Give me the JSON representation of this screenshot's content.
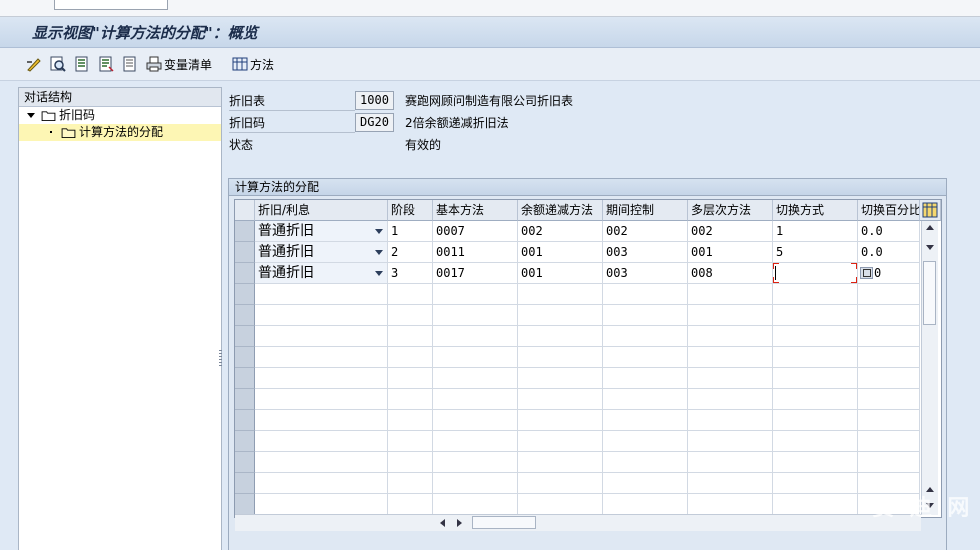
{
  "window": {
    "title": "显示视图\"计算方法的分配\"：概览"
  },
  "toolbar": {
    "variant_list_label": "变量清单",
    "method_label": "方法"
  },
  "tree": {
    "header": "对话结构",
    "items": [
      {
        "label": "折旧码"
      },
      {
        "label": "计算方法的分配"
      }
    ]
  },
  "fields": [
    {
      "label": "折旧表",
      "value": "1000",
      "text": "赛跑网顾问制造有限公司折旧表"
    },
    {
      "label": "折旧码",
      "value": "DG20",
      "text": "2倍余额递减折旧法"
    },
    {
      "label": "状态",
      "value": "",
      "text": "有效的"
    }
  ],
  "table": {
    "title": "计算方法的分配",
    "headers": [
      "折旧/利息",
      "阶段",
      "基本方法",
      "余额递减方法",
      "期间控制",
      "多层次方法",
      "切换方式",
      "切换百分比"
    ],
    "rows": [
      [
        "普通折旧",
        "1",
        "0007",
        "002",
        "002",
        "002",
        "1",
        "0.0"
      ],
      [
        "普通折旧",
        "2",
        "0011",
        "001",
        "003",
        "001",
        "5",
        "0.0"
      ],
      [
        "普通折旧",
        "3",
        "0017",
        "001",
        "003",
        "008",
        "",
        "0"
      ]
    ]
  },
  "watermark": "赛 迪 网"
}
